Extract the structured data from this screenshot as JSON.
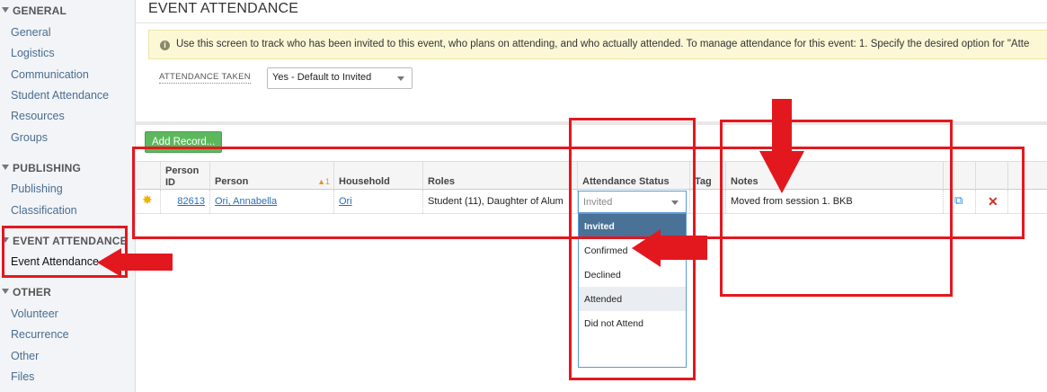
{
  "sidebar": {
    "sections": [
      {
        "title": "GENERAL",
        "items": [
          "General",
          "Logistics",
          "Communication",
          "Student Attendance",
          "Resources",
          "Groups"
        ]
      },
      {
        "title": "PUBLISHING",
        "items": [
          "Publishing",
          "Classification"
        ]
      },
      {
        "title": "EVENT ATTENDANCE",
        "items": [
          "Event Attendance"
        ]
      },
      {
        "title": "OTHER",
        "items": [
          "Volunteer",
          "Recurrence",
          "Other",
          "Files"
        ]
      }
    ]
  },
  "page": {
    "title": "EVENT ATTENDANCE",
    "info_text": "Use this screen to track who has been invited to this event, who plans on attending, and who actually attended. To manage attendance for this event: 1. Specify the desired option for \"Atte",
    "attendance_taken_label": "ATTENDANCE TAKEN",
    "attendance_taken_value": "Yes - Default to Invited",
    "add_record_label": "Add Record..."
  },
  "table": {
    "headers": {
      "person_id": "Person ID",
      "person": "Person",
      "person_sort": "1",
      "household": "Household",
      "roles": "Roles",
      "attendance_status": "Attendance Status",
      "tag": "Tag",
      "notes": "Notes"
    },
    "row": {
      "person_id": "82613",
      "person": "Ori, Annabella",
      "household": "Ori",
      "roles": "Student (11), Daughter of Alum",
      "attendance_status": "Invited",
      "notes": "Moved from session 1. BKB"
    }
  },
  "status_dropdown": {
    "options": [
      "Invited",
      "Confirmed",
      "Declined",
      "Attended",
      "Did not Attend"
    ],
    "selected": "Invited",
    "hovered": "Attended"
  },
  "icons": {
    "new_row": "star-icon",
    "open_record": "external-link-icon",
    "delete_record": "delete-x-icon"
  },
  "colors": {
    "annotation_red": "#e3181f",
    "add_button_green": "#5cb85c",
    "selected_option": "#4a7196",
    "link_blue": "#2a6fb3"
  }
}
